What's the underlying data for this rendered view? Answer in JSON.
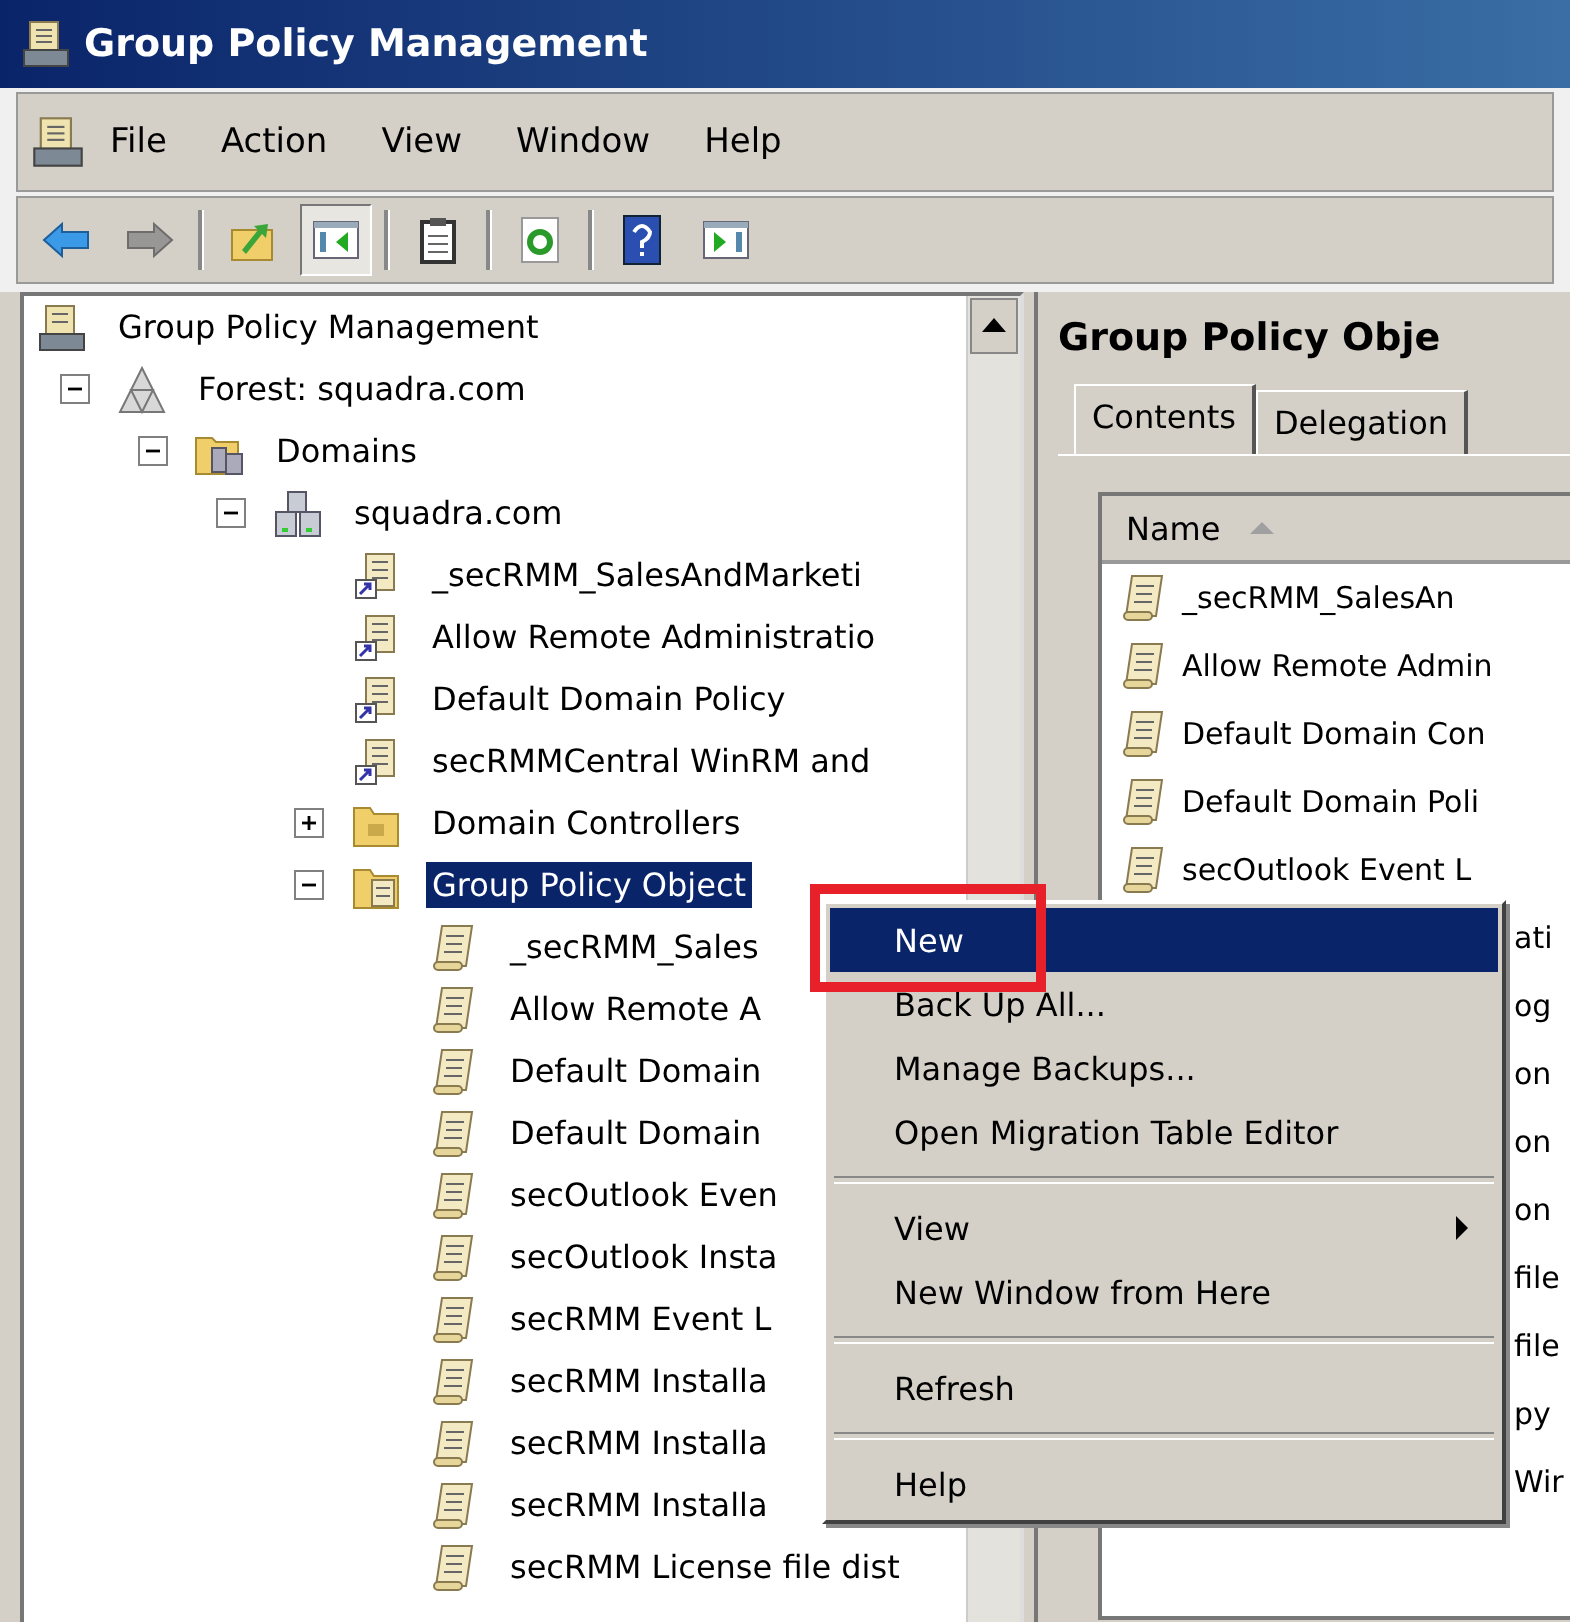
{
  "window": {
    "title": "Group Policy Management"
  },
  "menu_bar": [
    "File",
    "Action",
    "View",
    "Window",
    "Help"
  ],
  "toolbar": [
    {
      "kind": "back",
      "pressed": false,
      "disabled": false
    },
    {
      "kind": "forward",
      "pressed": false,
      "disabled": true
    },
    {
      "kind": "separator"
    },
    {
      "kind": "up",
      "pressed": false,
      "disabled": false
    },
    {
      "kind": "tree-toggle",
      "pressed": true,
      "disabled": false
    },
    {
      "kind": "separator"
    },
    {
      "kind": "export",
      "pressed": false,
      "disabled": false
    },
    {
      "kind": "separator"
    },
    {
      "kind": "refresh",
      "pressed": false,
      "disabled": false
    },
    {
      "kind": "separator"
    },
    {
      "kind": "help",
      "pressed": false,
      "disabled": false
    },
    {
      "kind": "action-pane",
      "pressed": false,
      "disabled": false
    }
  ],
  "tree": [
    {
      "kind": "console",
      "label": "Group Policy Management",
      "selected": false,
      "children": [
        {
          "kind": "forest",
          "label": "Forest: squadra.com",
          "selected": false,
          "expanded": true,
          "children": [
            {
              "kind": "domains",
              "label": "Domains",
              "selected": false,
              "expanded": true,
              "children": [
                {
                  "kind": "domain",
                  "label": "squadra.com",
                  "selected": false,
                  "expanded": true,
                  "children": [
                    {
                      "kind": "gpo-link",
                      "label": "_secRMM_SalesAndMarketi",
                      "selected": false
                    },
                    {
                      "kind": "gpo-link",
                      "label": "Allow Remote Administratio",
                      "selected": false
                    },
                    {
                      "kind": "gpo-link",
                      "label": "Default Domain Policy",
                      "selected": false
                    },
                    {
                      "kind": "gpo-link",
                      "label": "secRMMCentral WinRM and",
                      "selected": false
                    },
                    {
                      "kind": "ou-folder",
                      "label": "Domain Controllers",
                      "selected": false,
                      "expanded": false
                    },
                    {
                      "kind": "gpo-folder",
                      "label": "Group Policy Object",
                      "selected": true,
                      "expanded": true,
                      "children": [
                        {
                          "kind": "gpo",
                          "label": "_secRMM_Sales",
                          "selected": false
                        },
                        {
                          "kind": "gpo",
                          "label": "Allow Remote A",
                          "selected": false
                        },
                        {
                          "kind": "gpo",
                          "label": "Default Domain",
                          "selected": false
                        },
                        {
                          "kind": "gpo",
                          "label": "Default Domain",
                          "selected": false
                        },
                        {
                          "kind": "gpo",
                          "label": "secOutlook Even",
                          "selected": false
                        },
                        {
                          "kind": "gpo",
                          "label": "secOutlook Insta",
                          "selected": false
                        },
                        {
                          "kind": "gpo",
                          "label": "secRMM Event L",
                          "selected": false
                        },
                        {
                          "kind": "gpo",
                          "label": "secRMM Installa",
                          "selected": false
                        },
                        {
                          "kind": "gpo",
                          "label": "secRMM Installa",
                          "selected": false
                        },
                        {
                          "kind": "gpo",
                          "label": "secRMM Installa",
                          "selected": false
                        },
                        {
                          "kind": "gpo",
                          "label": "secRMM License file dist",
                          "selected": false
                        }
                      ]
                    }
                  ]
                }
              ]
            }
          ]
        }
      ]
    }
  ],
  "details": {
    "title": "Group Policy Obje",
    "tabs": [
      {
        "label": "Contents",
        "selected": true
      },
      {
        "label": "Delegation",
        "selected": false
      }
    ],
    "columns": [
      {
        "label": "Name",
        "sorted": true
      }
    ],
    "rows": [
      {
        "kind": "full",
        "text": "_secRMM_SalesAn"
      },
      {
        "kind": "full",
        "text": "Allow Remote Admin"
      },
      {
        "kind": "full",
        "text": "Default Domain Con"
      },
      {
        "kind": "full",
        "text": "Default Domain Poli"
      },
      {
        "kind": "full",
        "text": "secOutlook Event L"
      },
      {
        "kind": "partial",
        "text": "ati"
      },
      {
        "kind": "partial",
        "text": "og"
      },
      {
        "kind": "partial",
        "text": "on"
      },
      {
        "kind": "partial",
        "text": "on"
      },
      {
        "kind": "partial",
        "text": "on"
      },
      {
        "kind": "partial",
        "text": "file"
      },
      {
        "kind": "partial",
        "text": "file"
      },
      {
        "kind": "partial",
        "text": "py"
      },
      {
        "kind": "partial",
        "text": "Wir"
      }
    ]
  },
  "context_menu": {
    "items": [
      {
        "kind": "item",
        "label": "New",
        "selected": true,
        "submenu": false,
        "callout": true
      },
      {
        "kind": "item",
        "label": "Back Up All...",
        "selected": false,
        "submenu": false,
        "callout": false
      },
      {
        "kind": "item",
        "label": "Manage Backups...",
        "selected": false,
        "submenu": false,
        "callout": false
      },
      {
        "kind": "item",
        "label": "Open Migration Table Editor",
        "selected": false,
        "submenu": false,
        "callout": false
      },
      {
        "kind": "separator"
      },
      {
        "kind": "item",
        "label": "View",
        "selected": false,
        "submenu": true,
        "callout": false
      },
      {
        "kind": "item",
        "label": "New Window from Here",
        "selected": false,
        "submenu": false,
        "callout": false
      },
      {
        "kind": "separator"
      },
      {
        "kind": "item",
        "label": "Refresh",
        "selected": false,
        "submenu": false,
        "callout": false
      },
      {
        "kind": "separator"
      },
      {
        "kind": "item",
        "label": "Help",
        "selected": false,
        "submenu": false,
        "callout": false
      }
    ]
  }
}
